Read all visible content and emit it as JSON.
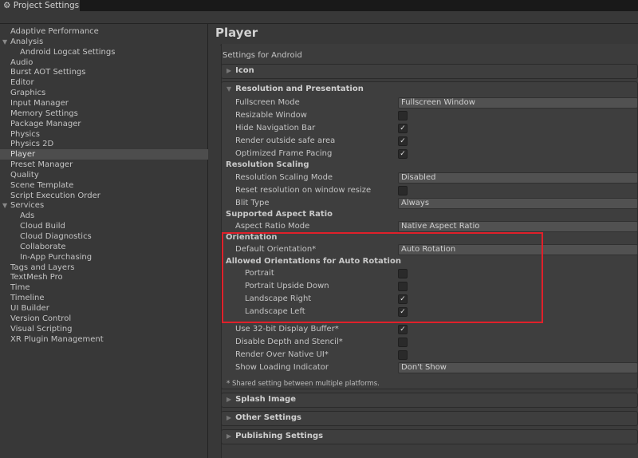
{
  "window": {
    "tab_title": "Project Settings"
  },
  "sidebar": {
    "items": [
      {
        "label": "Adaptive Performance"
      },
      {
        "label": "Analysis"
      },
      {
        "label": "Android Logcat Settings"
      },
      {
        "label": "Audio"
      },
      {
        "label": "Burst AOT Settings"
      },
      {
        "label": "Editor"
      },
      {
        "label": "Graphics"
      },
      {
        "label": "Input Manager"
      },
      {
        "label": "Memory Settings"
      },
      {
        "label": "Package Manager"
      },
      {
        "label": "Physics"
      },
      {
        "label": "Physics 2D"
      },
      {
        "label": "Player"
      },
      {
        "label": "Preset Manager"
      },
      {
        "label": "Quality"
      },
      {
        "label": "Scene Template"
      },
      {
        "label": "Script Execution Order"
      },
      {
        "label": "Services"
      },
      {
        "label": "Ads"
      },
      {
        "label": "Cloud Build"
      },
      {
        "label": "Cloud Diagnostics"
      },
      {
        "label": "Collaborate"
      },
      {
        "label": "In-App Purchasing"
      },
      {
        "label": "Tags and Layers"
      },
      {
        "label": "TextMesh Pro"
      },
      {
        "label": "Time"
      },
      {
        "label": "Timeline"
      },
      {
        "label": "UI Builder"
      },
      {
        "label": "Version Control"
      },
      {
        "label": "Visual Scripting"
      },
      {
        "label": "XR Plugin Management"
      }
    ]
  },
  "main": {
    "title": "Player",
    "platform_label": "Settings for Android",
    "icon_section": "Icon",
    "resolution": {
      "title": "Resolution and Presentation",
      "fullscreen_mode": {
        "label": "Fullscreen Mode",
        "value": "Fullscreen Window"
      },
      "resizable_window": {
        "label": "Resizable Window",
        "checked": false
      },
      "hide_nav_bar": {
        "label": "Hide Navigation Bar",
        "checked": true
      },
      "render_outside_safe": {
        "label": "Render outside safe area",
        "checked": true
      },
      "optimized_frame_pacing": {
        "label": "Optimized Frame Pacing",
        "checked": true
      },
      "scaling_header": "Resolution Scaling",
      "scaling_mode": {
        "label": "Resolution Scaling Mode",
        "value": "Disabled"
      },
      "reset_resolution": {
        "label": "Reset resolution on window resize",
        "checked": false
      },
      "blit_type": {
        "label": "Blit Type",
        "value": "Always"
      },
      "aspect_header": "Supported Aspect Ratio",
      "aspect_mode": {
        "label": "Aspect Ratio Mode",
        "value": "Native Aspect Ratio"
      },
      "orientation_header": "Orientation",
      "default_orientation": {
        "label": "Default Orientation*",
        "value": "Auto Rotation"
      },
      "allowed_header": "Allowed Orientations for Auto Rotation",
      "portrait": {
        "label": "Portrait",
        "checked": false
      },
      "portrait_upside": {
        "label": "Portrait Upside Down",
        "checked": false
      },
      "landscape_right": {
        "label": "Landscape Right",
        "checked": true
      },
      "landscape_left": {
        "label": "Landscape Left",
        "checked": true
      },
      "display_buffer": {
        "label": "Use 32-bit Display Buffer*",
        "checked": true
      },
      "disable_depth": {
        "label": "Disable Depth and Stencil*",
        "checked": false
      },
      "render_over_native": {
        "label": "Render Over Native UI*",
        "checked": false
      },
      "loading_indicator": {
        "label": "Show Loading Indicator",
        "value": "Don't Show"
      },
      "note": "* Shared setting between multiple platforms."
    },
    "splash_section": "Splash Image",
    "other_section": "Other Settings",
    "publishing_section": "Publishing Settings",
    "check_glyph": "✓"
  }
}
